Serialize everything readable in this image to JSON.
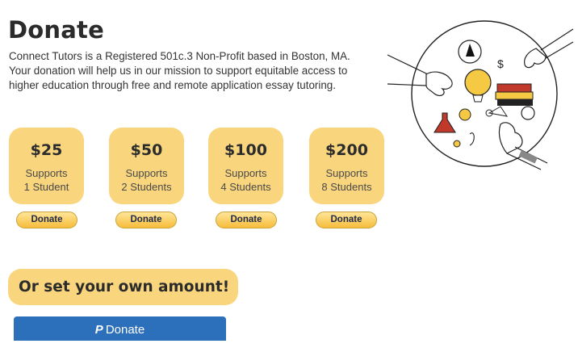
{
  "page": {
    "title": "Donate",
    "description": "Connect Tutors is a Registered 501c.3 Non-Profit based in Boston, MA. Your donation will help us in our mission to support equitable access to higher education through free and remote application essay tutoring."
  },
  "tiers": [
    {
      "amount": "$25",
      "supports": "Supports",
      "students": "1 Student",
      "button": "Donate"
    },
    {
      "amount": "$50",
      "supports": "Supports",
      "students": "2 Students",
      "button": "Donate"
    },
    {
      "amount": "$100",
      "supports": "Supports",
      "students": "4 Students",
      "button": "Donate"
    },
    {
      "amount": "$200",
      "supports": "Supports",
      "students": "8 Students",
      "button": "Donate"
    }
  ],
  "custom": {
    "heading": "Or set your own amount!",
    "paypal_label": "Donate",
    "paypal_icon": "paypal-icon"
  },
  "illustration": {
    "icon": "hands-exchanging-objects-illustration",
    "glyph": "$"
  },
  "colors": {
    "card": "#f9d57e",
    "paypal_gold": "#f6bd3a",
    "paypal_blue": "#2c6fba"
  }
}
